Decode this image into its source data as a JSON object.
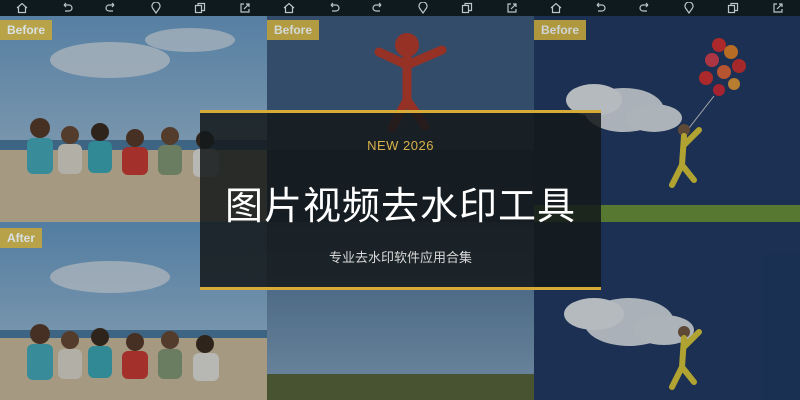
{
  "panels": {
    "before_label": "Before",
    "after_label": "After"
  },
  "toolbar": {
    "icons": [
      "home-icon",
      "undo-icon",
      "redo-icon",
      "location-icon",
      "copy-icon",
      "external-link-icon"
    ]
  },
  "card": {
    "tag": "NEW 2026",
    "title": "图片视频去水印工具",
    "subtitle": "专业去水印软件应用合集"
  },
  "colors": {
    "accent_gold": "#d7ab38",
    "card_bg": "#14181a",
    "toolbar_bg": "#0e1a1e"
  }
}
